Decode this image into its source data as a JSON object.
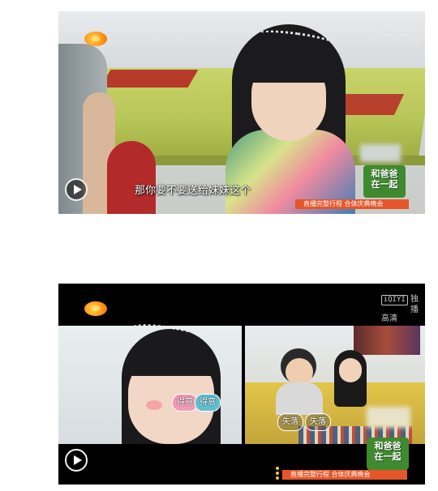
{
  "frames": [
    {
      "subtitle": "那你要不要送给妹妹这个",
      "watermark": {
        "brand_mark": "iQIYI",
        "brand_text": "独播"
      },
      "show_logo": [
        "和爸爸",
        "在一起"
      ],
      "ticker": "直播完整行程  合体庆典晚会"
    },
    {
      "watermark": {
        "brand_mark": "iQIYI",
        "brand_text": "独播",
        "quality": "高清"
      },
      "stickers_left": [
        "得意",
        "得意"
      ],
      "stickers_right": [
        "失落",
        "失落"
      ],
      "show_logo": [
        "和爸爸",
        "在一起"
      ],
      "ticker": "直播完整行程  合体庆典晚会"
    }
  ],
  "icons": {
    "station_logo": "mango-tv-logo-icon",
    "play": "play-icon"
  },
  "colors": {
    "ticker": "#e5562a",
    "show_logo": "#3f8a2f",
    "station_logo": "#ff9a1a"
  }
}
